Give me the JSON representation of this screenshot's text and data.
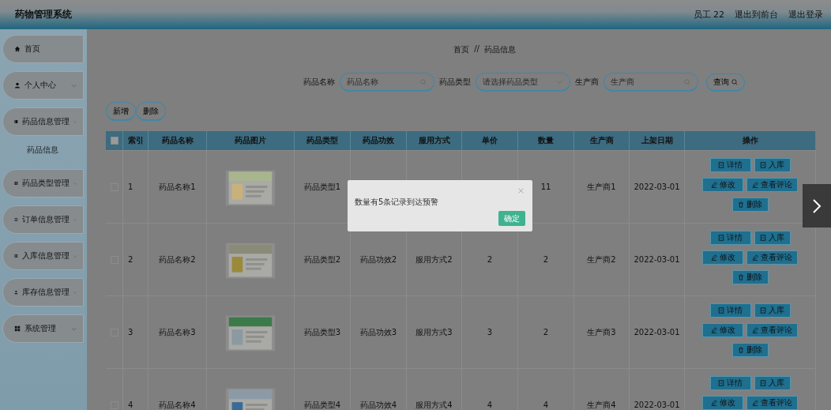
{
  "header": {
    "title": "药物管理系统",
    "user": "员工 22",
    "links": [
      "退出到前台",
      "退出登录"
    ]
  },
  "sidebar": {
    "items": [
      {
        "label": "首页",
        "kind": "link"
      },
      {
        "label": "个人中心",
        "kind": "menu"
      },
      {
        "label": "药品信息管理",
        "kind": "menu",
        "children": [
          {
            "label": "药品信息"
          }
        ]
      },
      {
        "label": "药品类型管理",
        "kind": "menu"
      },
      {
        "label": "订单信息管理",
        "kind": "menu"
      },
      {
        "label": "入库信息管理",
        "kind": "menu"
      },
      {
        "label": "库存信息管理",
        "kind": "menu"
      },
      {
        "label": "系统管理",
        "kind": "menu"
      }
    ]
  },
  "breadcrumb": {
    "items": [
      "首页",
      "药品信息"
    ],
    "separator": "//"
  },
  "search": {
    "fields": [
      {
        "label": "药品名称",
        "placeholder": "药品名称",
        "kind": "input"
      },
      {
        "label": "药品类型",
        "placeholder": "请选择药品类型",
        "kind": "select"
      },
      {
        "label": "生产商",
        "placeholder": "生产商",
        "kind": "input"
      }
    ],
    "button": "查询"
  },
  "toolbar": [
    "新增",
    "删除"
  ],
  "table": {
    "header_checked": false,
    "columns": [
      "索引",
      "药品名称",
      "药品图片",
      "药品类型",
      "药品功效",
      "服用方式",
      "单价",
      "数量",
      "生产商",
      "上架日期",
      "操作"
    ],
    "rows": [
      {
        "checked": false,
        "index": "1",
        "name": "药品名称1",
        "picture": {
          "kind": "picture"
        },
        "type": "药品类型1",
        "quantity": "11",
        "maker": "生产商1",
        "date": "2022-03-01",
        "actions": [
          {
            "label": "详情",
            "kind": "detail"
          },
          {
            "label": "入库",
            "kind": "stock"
          },
          {
            "label": "修改",
            "kind": "edit"
          },
          {
            "label": "查看评论",
            "kind": "comment"
          },
          {
            "label": "删除",
            "kind": "delete"
          }
        ]
      },
      {
        "checked": false,
        "index": "2",
        "name": "药品名称2",
        "picture": {
          "kind": "picture"
        },
        "type": "药品类型2",
        "efficacy": "药品功效2",
        "usage": "服用方式2",
        "price": "2",
        "quantity": "2",
        "maker": "生产商2",
        "date": "2022-03-01",
        "actions": [
          {
            "label": "详情",
            "kind": "detail"
          },
          {
            "label": "入库",
            "kind": "stock"
          },
          {
            "label": "修改",
            "kind": "edit"
          },
          {
            "label": "查看评论",
            "kind": "comment"
          },
          {
            "label": "删除",
            "kind": "delete"
          }
        ]
      },
      {
        "checked": false,
        "index": "3",
        "name": "药品名称3",
        "picture": {
          "kind": "picture"
        },
        "type": "药品类型3",
        "efficacy": "药品功效3",
        "usage": "服用方式3",
        "price": "3",
        "quantity": "2",
        "maker": "生产商3",
        "date": "2022-03-01",
        "actions": [
          {
            "label": "详情",
            "kind": "detail"
          },
          {
            "label": "入库",
            "kind": "stock"
          },
          {
            "label": "修改",
            "kind": "edit"
          },
          {
            "label": "查看评论",
            "kind": "comment"
          },
          {
            "label": "删除",
            "kind": "delete"
          }
        ]
      },
      {
        "checked": false,
        "index": "4",
        "name": "药品名称4",
        "picture": {
          "kind": "picture"
        },
        "type": "药品类型4",
        "efficacy": "药品功效4",
        "usage": "服用方式4",
        "price": "4",
        "quantity": "4",
        "maker": "生产商4",
        "date": "2022-03-01",
        "actions": [
          {
            "label": "详情",
            "kind": "detail"
          },
          {
            "label": "入库",
            "kind": "stock"
          },
          {
            "label": "修改",
            "kind": "edit"
          },
          {
            "label": "查看评论",
            "kind": "comment"
          }
        ]
      }
    ]
  },
  "dialog": {
    "message": "数量有5条记录到达预警",
    "button": "确定"
  }
}
